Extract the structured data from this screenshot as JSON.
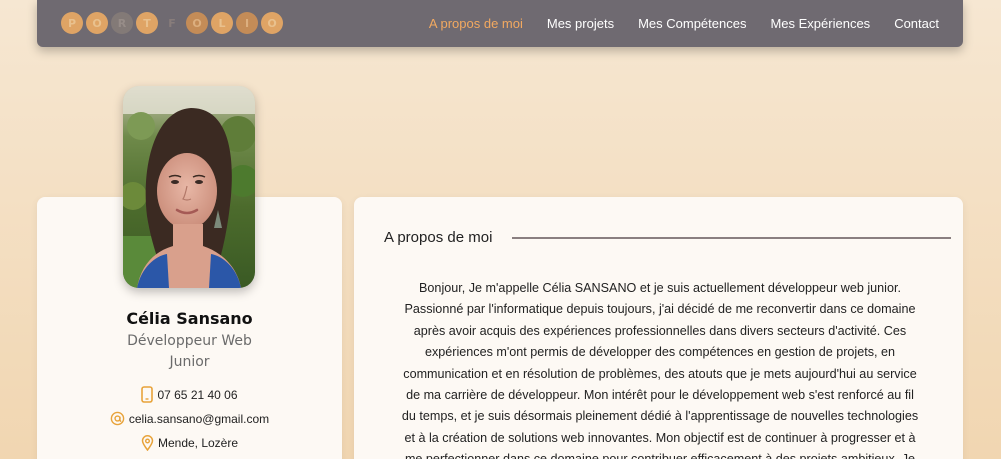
{
  "nav": {
    "logo_letters": [
      "P",
      "O",
      "R",
      "T",
      "F",
      "O",
      "L",
      "I",
      "O"
    ],
    "links": [
      {
        "label": "A propos de moi",
        "active": true
      },
      {
        "label": "Mes projets",
        "active": false
      },
      {
        "label": "Mes Compétences",
        "active": false
      },
      {
        "label": "Mes Expériences",
        "active": false
      },
      {
        "label": "Contact",
        "active": false
      }
    ]
  },
  "profile": {
    "name": "Célia Sansano",
    "role_line1": "Développeur Web",
    "role_line2": "Junior",
    "phone": "07 65 21 40 06",
    "email": "celia.sansano@gmail.com",
    "location": "Mende, Lozère",
    "icons": {
      "phone": "phone-icon",
      "email": "at-sign-icon",
      "location": "map-pin-icon"
    }
  },
  "about": {
    "title": "A propos de moi",
    "lines": [
      "Bonjour, Je m'appelle Célia SANSANO et je suis actuellement développeur web junior.",
      "Passionné par l'informatique depuis toujours, j'ai décidé de me reconvertir dans ce domaine",
      "après avoir acquis des expériences professionnelles dans divers secteurs d'activité. Ces",
      "expériences m'ont permis de développer des compétences en gestion de projets, en",
      "communication et en résolution de problèmes, des atouts que je mets aujourd'hui au service",
      "de ma carrière de développeur. Mon intérêt pour le développement web s'est renforcé au fil",
      "du temps, et je suis désormais pleinement dédié à l'apprentissage de nouvelles technologies",
      "et à la création de solutions web innovantes. Mon objectif est de continuer à progresser et à",
      "me perfectionner dans ce domaine pour contribuer efficacement à des projets ambitieux. Je"
    ]
  },
  "colors": {
    "accent": "#f2a960",
    "nav_bg": "#6f6a71",
    "card_bg": "#fdf9f4",
    "icon": "#e8a33a"
  }
}
